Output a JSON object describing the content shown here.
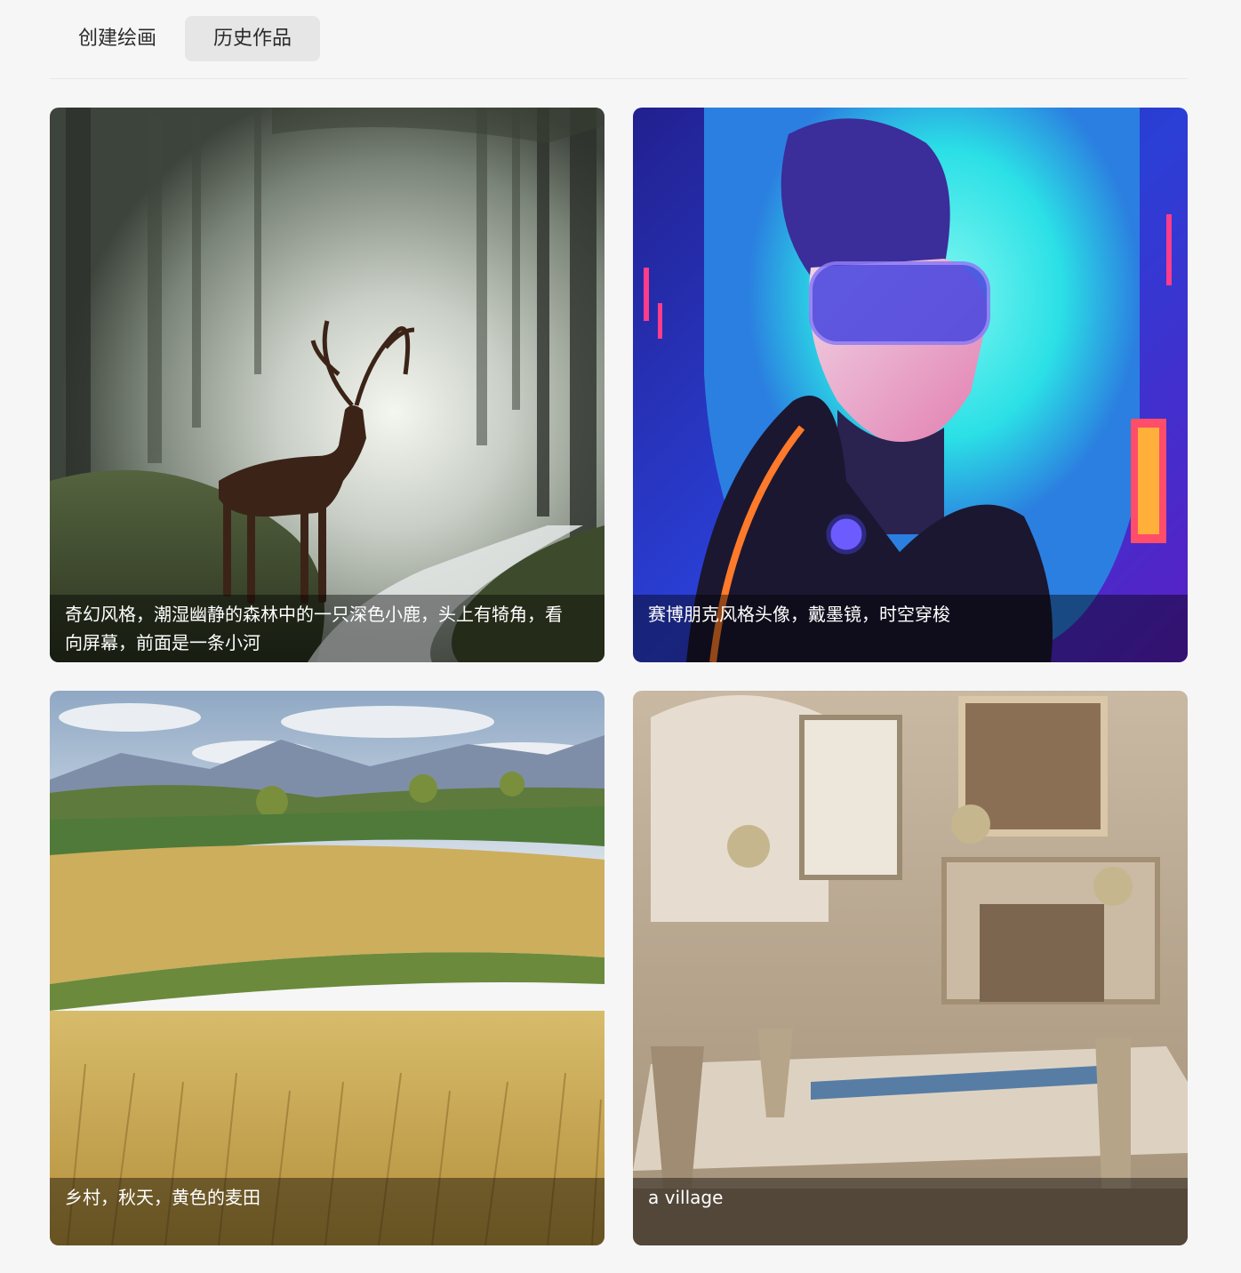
{
  "tabs": {
    "create_label": "创建绘画",
    "history_label": "历史作品",
    "active": "history"
  },
  "gallery": {
    "items": [
      {
        "caption": "奇幻风格，潮湿幽静的森林中的一只深色小鹿，头上有犄角，看向屏幕，前面是一条小河"
      },
      {
        "caption": "赛博朋克风格头像，戴墨镜，时空穿梭"
      },
      {
        "caption": "乡村，秋天，黄色的麦田"
      },
      {
        "caption": "a village"
      }
    ]
  },
  "colors": {
    "page_background": "#f6f6f6",
    "active_tab_background": "#e6e6e6",
    "caption_overlay": "rgba(0,0,0,0.42)"
  }
}
